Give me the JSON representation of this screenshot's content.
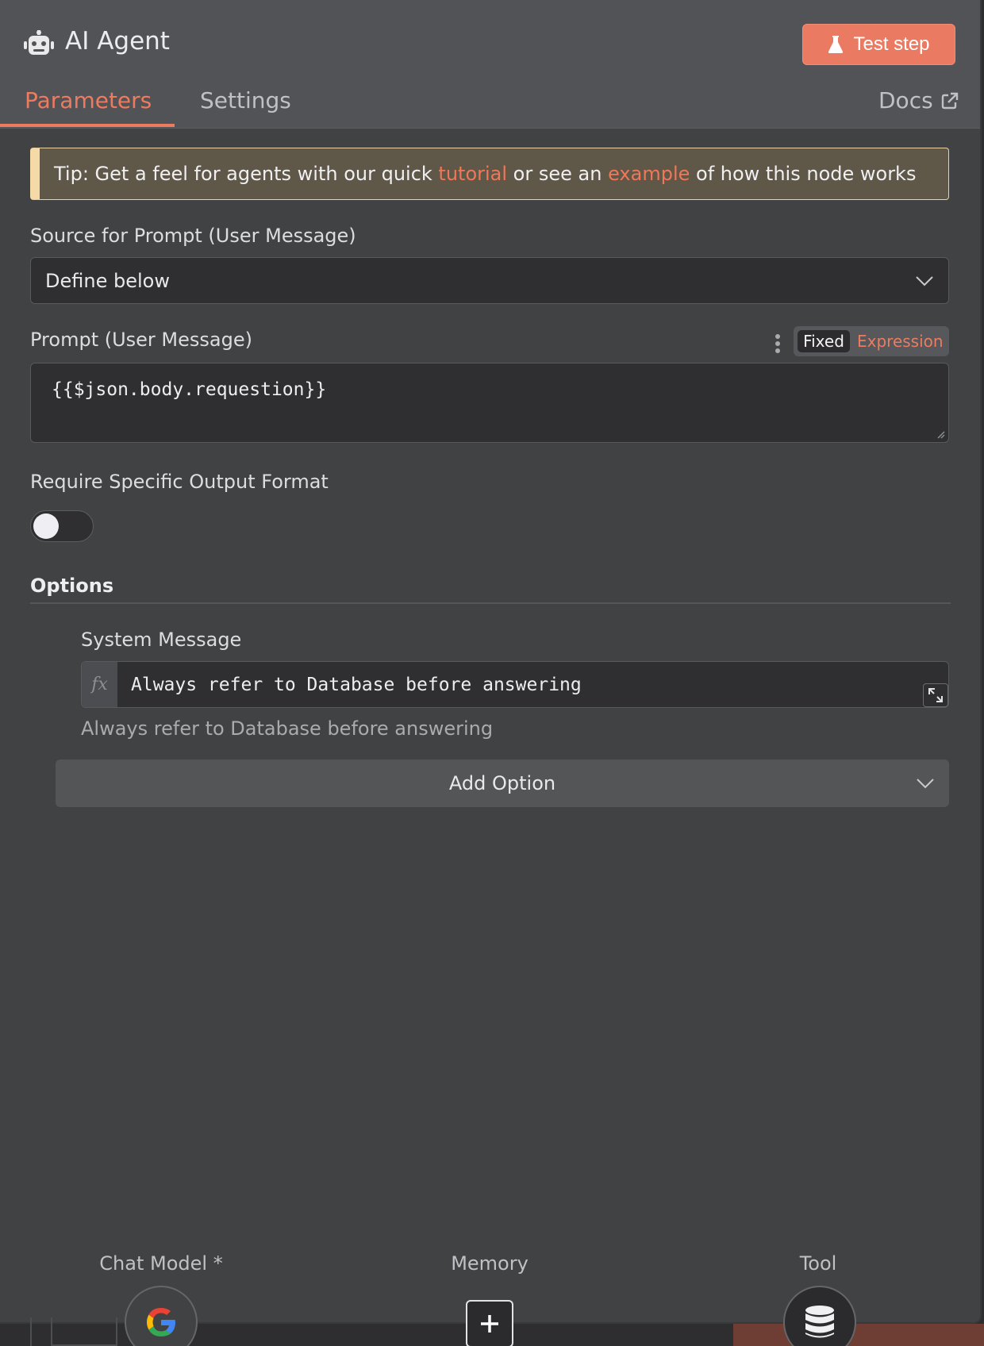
{
  "header": {
    "title": "AI Agent",
    "icon": "robot-icon",
    "test_step_label": "Test step",
    "test_step_icon": "flask-icon"
  },
  "tabs": [
    {
      "label": "Parameters",
      "active": true
    },
    {
      "label": "Settings",
      "active": false
    }
  ],
  "docs": {
    "label": "Docs",
    "icon": "external-link-icon"
  },
  "tip": {
    "prefix": "Tip: Get a feel for agents with our quick ",
    "link1": "tutorial",
    "middle": " or see an ",
    "link2": "example",
    "suffix": " of how this node works"
  },
  "source_prompt": {
    "label": "Source for Prompt (User Message)",
    "value": "Define below"
  },
  "prompt": {
    "label": "Prompt (User Message)",
    "mode_fixed": "Fixed",
    "mode_expression": "Expression",
    "value": "{{$json.body.requestion}}"
  },
  "output_format": {
    "label": "Require Specific Output Format",
    "enabled": false
  },
  "options": {
    "title": "Options",
    "system_message": {
      "label": "System Message",
      "fx": "fx",
      "value": "Always refer to Database before answering",
      "hint": "Always refer to Database before answering"
    },
    "add_option_label": "Add Option"
  },
  "connections": [
    {
      "label": "Chat Model *",
      "icon": "google-icon"
    },
    {
      "label": "Memory",
      "icon": "plus-icon"
    },
    {
      "label": "Tool",
      "icon": "database-icon"
    }
  ],
  "colors": {
    "accent": "#ec7b60",
    "panel": "#414244",
    "header": "#525356",
    "input_bg": "#2f2f31"
  }
}
